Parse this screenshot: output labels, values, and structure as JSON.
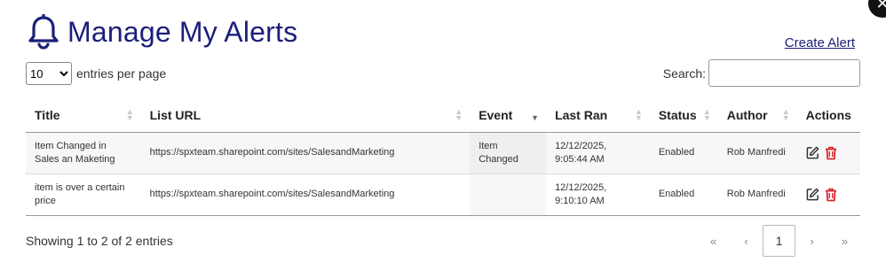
{
  "title": "Manage My Alerts",
  "create_alert": "Create Alert",
  "entries": {
    "selected": "10",
    "label": "entries per page"
  },
  "search": {
    "label": "Search:",
    "value": ""
  },
  "columns": [
    "Title",
    "List URL",
    "Event",
    "Last Ran",
    "Status",
    "Author",
    "Actions"
  ],
  "rows": [
    {
      "title": "Item Changed in Sales an Maketing",
      "url": "https://spxteam.sharepoint.com/sites/SalesandMarketing",
      "event": "Item Changed",
      "last_ran": "12/12/2025, 9:05:44 AM",
      "status": "Enabled",
      "author": "Rob Manfredi"
    },
    {
      "title": "item is over a certain price",
      "url": "https://spxteam.sharepoint.com/sites/SalesandMarketing",
      "event": "",
      "last_ran": "12/12/2025, 9:10:10 AM",
      "status": "Enabled",
      "author": "Rob Manfredi"
    }
  ],
  "footer": {
    "info": "Showing 1 to 2 of 2 entries"
  },
  "pagination": {
    "first": "«",
    "prev": "‹",
    "current": "1",
    "next": "›",
    "last": "»"
  },
  "colors": {
    "accent": "#1b1f7a",
    "delete": "#d9262c",
    "edit": "#333333"
  },
  "icons": {
    "bell": "bell-icon",
    "edit": "edit-icon",
    "delete": "trash-icon",
    "close": "close-icon"
  }
}
